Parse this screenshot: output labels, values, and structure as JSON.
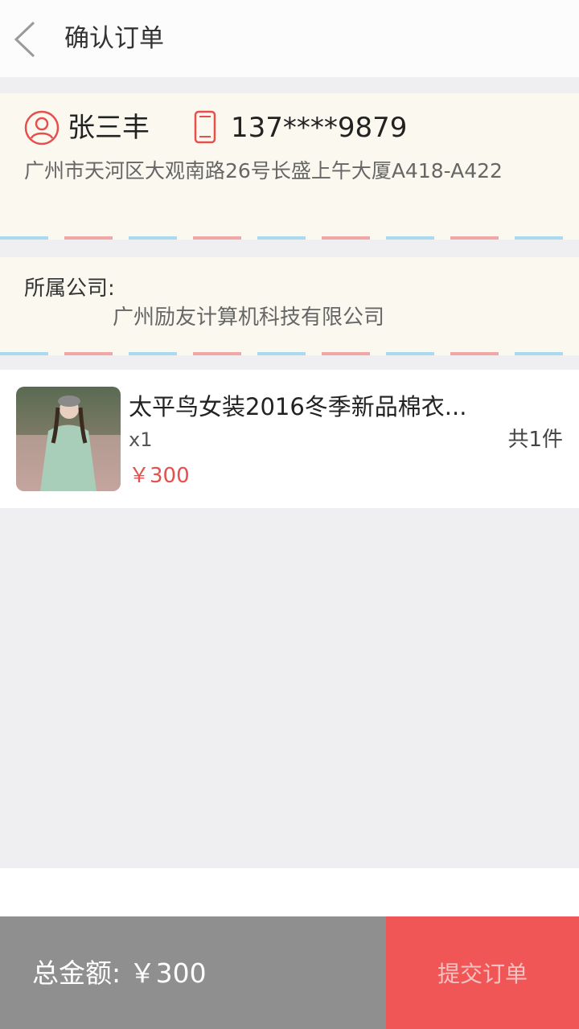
{
  "header": {
    "title": "确认订单"
  },
  "address_card": {
    "name": "张三丰",
    "phone": "137****9879",
    "address": "广州市天河区大观南路26号长盛上午大厦A418-A422"
  },
  "company_card": {
    "label": "所属公司:",
    "value": "广州励友计算机科技有限公司"
  },
  "product": {
    "title": "太平鸟女装2016冬季新品棉衣...",
    "quantity": "x1",
    "price": "￥300",
    "count": "共1件"
  },
  "footer": {
    "total_label": "总金额: ￥300",
    "submit_label": "提交订单"
  },
  "colors": {
    "accent": "#f05656",
    "price": "#e5504e",
    "card_bg": "#fbf9ef",
    "footer_bg": "#8f8f8f"
  }
}
